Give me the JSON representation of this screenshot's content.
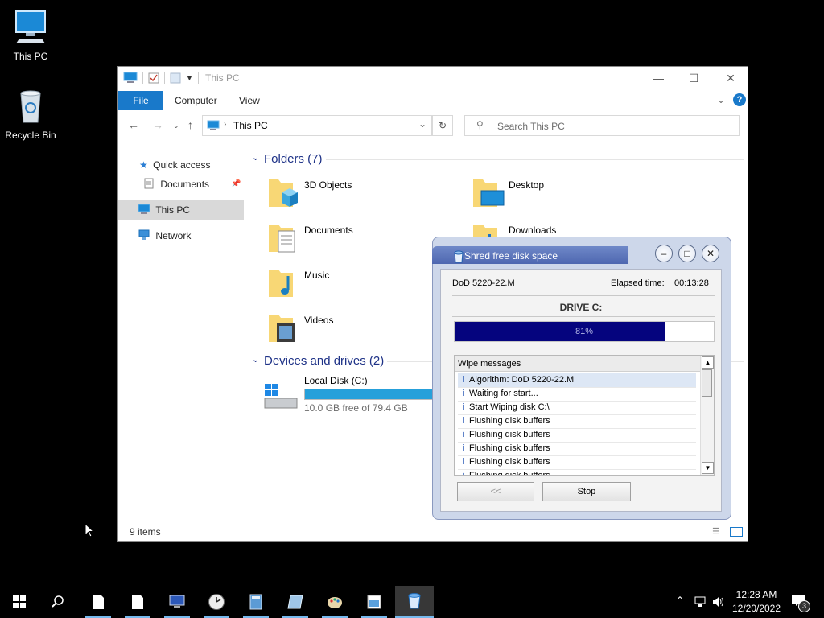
{
  "desktop": {
    "icons": [
      {
        "label": "This PC"
      },
      {
        "label": "Recycle Bin"
      }
    ]
  },
  "explorer": {
    "title": "This PC",
    "ribbon_tabs": [
      "File",
      "Computer",
      "View"
    ],
    "address": "This PC",
    "search_placeholder": "Search This PC",
    "nav": {
      "quick_access": "Quick access",
      "documents": "Documents",
      "this_pc": "This PC",
      "network": "Network"
    },
    "folders_header": "Folders (7)",
    "folders": [
      "3D Objects",
      "Desktop",
      "Documents",
      "Downloads",
      "Music",
      "Videos"
    ],
    "devices_header": "Devices and drives (2)",
    "drive": {
      "name": "Local Disk (C:)",
      "free_text": "10.0 GB free of 79.4 GB",
      "used_fraction": 0.874
    },
    "status": "9 items"
  },
  "shred": {
    "title": "Shred free disk space",
    "algorithm": "DoD 5220-22.M",
    "elapsed_label": "Elapsed time:",
    "elapsed_value": "00:13:28",
    "drive_label": "DRIVE C:",
    "progress_percent": 81,
    "progress_text": "81%",
    "messages_header": "Wipe messages",
    "messages": [
      "Algorithm: DoD 5220-22.M",
      "Waiting for start...",
      "Start Wiping disk C:\\",
      "Flushing disk buffers",
      "Flushing disk buffers",
      "Flushing disk buffers",
      "Flushing disk buffers",
      "Flushing disk buffers"
    ],
    "back_button": "<<",
    "stop_button": "Stop"
  },
  "taskbar": {
    "time": "12:28 AM",
    "date": "12/20/2022",
    "notification_count": "3"
  },
  "colors": {
    "file_tab": "#1979ca",
    "progress": "#05047e",
    "drive_bar": "#26a0da"
  }
}
